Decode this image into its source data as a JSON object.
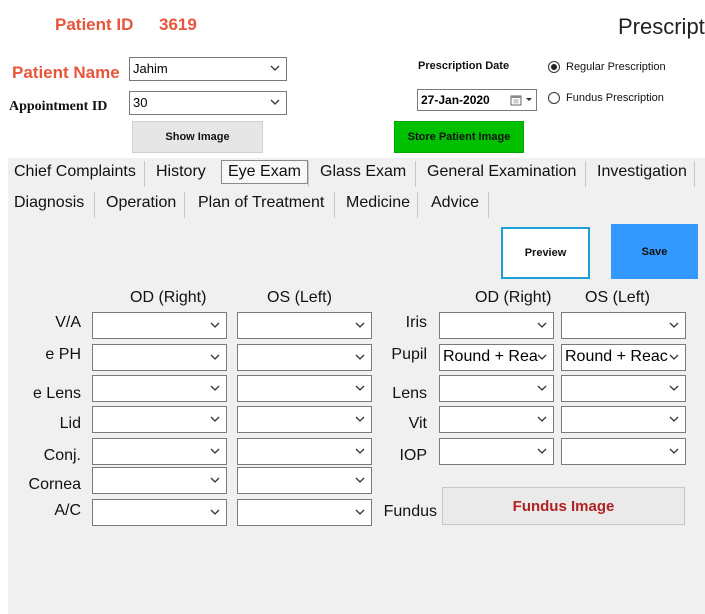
{
  "header": {
    "patient_id_label": "Patient ID",
    "patient_id_value": "3619",
    "title_partial": "Prescript"
  },
  "form": {
    "patient_name_label": "Patient Name",
    "patient_name_value": "Jahim",
    "appointment_id_label": "Appointment ID",
    "appointment_id_value": "30",
    "prescription_date_label": "Prescription Date",
    "prescription_date_value": "27-Jan-2020",
    "radio_regular": "Regular Prescription",
    "radio_fundus": "Fundus Prescription",
    "selected_radio": "regular",
    "show_image_button": "Show Image",
    "store_image_button": "Store Patient Image"
  },
  "tabs": {
    "row1": [
      "Chief Complaints",
      "History",
      "Eye Exam",
      "Glass Exam",
      "General Examination",
      "Investigation"
    ],
    "row2": [
      "Diagnosis",
      "Operation",
      "Plan of Treatment",
      "Medicine",
      "Advice"
    ],
    "active": "Eye Exam"
  },
  "actions": {
    "preview_label": "Preview",
    "save_label": "Save"
  },
  "eye_exam": {
    "left_head_od": "OD (Right)",
    "left_head_os": "OS (Left)",
    "right_head_od": "OD (Right)",
    "right_head_os": "OS (Left)",
    "left_rows": [
      {
        "label": "V/A",
        "od": "",
        "os": ""
      },
      {
        "label": "e PH",
        "od": "",
        "os": ""
      },
      {
        "label": "e Lens",
        "od": "",
        "os": ""
      },
      {
        "label": "Lid",
        "od": "",
        "os": ""
      },
      {
        "label": "Conj.",
        "od": "",
        "os": ""
      },
      {
        "label": "Cornea",
        "od": "",
        "os": ""
      },
      {
        "label": "A/C",
        "od": "",
        "os": ""
      }
    ],
    "right_rows": [
      {
        "label": "Iris",
        "od": "",
        "os": ""
      },
      {
        "label": "Pupil",
        "od": "Round + Rea",
        "os": "Round + Reac"
      },
      {
        "label": "Lens",
        "od": "",
        "os": ""
      },
      {
        "label": "Vit",
        "od": "",
        "os": ""
      },
      {
        "label": "IOP",
        "od": "",
        "os": ""
      }
    ],
    "fundus_label": "Fundus",
    "fundus_button": "Fundus Image"
  },
  "colors": {
    "accent_red": "#e8553b",
    "save_blue": "#3399ff",
    "store_green": "#00c000",
    "preview_border": "#1e9ed6",
    "fundus_text": "#b22222"
  },
  "icons": {
    "dropdown": "chevron-down-icon",
    "calendar": "calendar-icon"
  }
}
